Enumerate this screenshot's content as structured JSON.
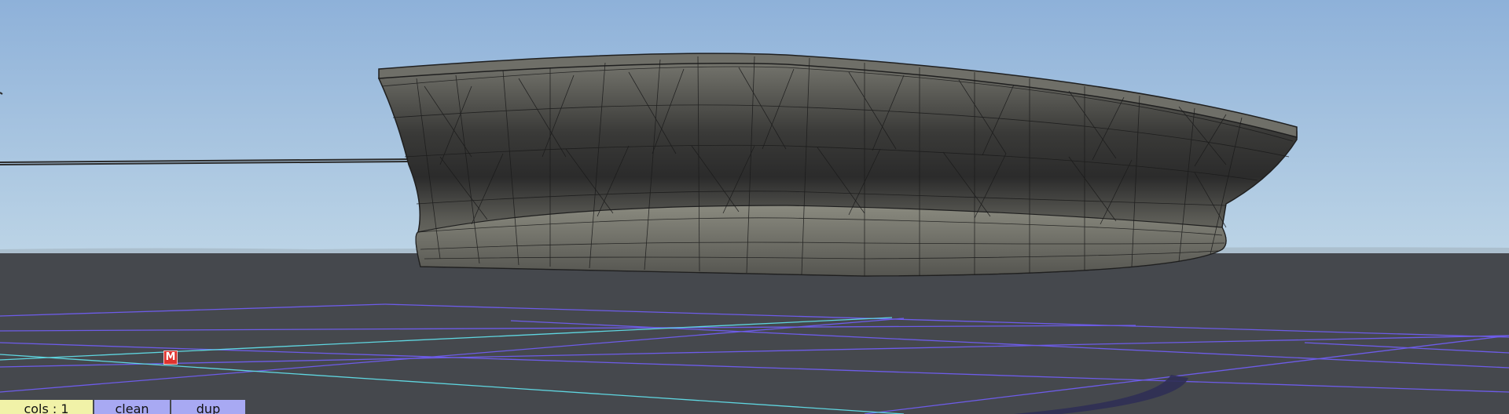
{
  "viewport": {
    "marker_label": "M"
  },
  "toolbar": {
    "cols_label": "cols : 1",
    "clean_label": "clean",
    "dup_label": "dup"
  },
  "colors": {
    "sky_top": "#8db0d8",
    "sky_bottom": "#b9d2e6",
    "ground": "#45484d",
    "grid_major": "#7a63f0",
    "grid_axis": "#5fd6e0",
    "marker": "#e0332e",
    "toolbar_cols": "#f1f2a8",
    "toolbar_buttons": "#a8a9f3"
  }
}
